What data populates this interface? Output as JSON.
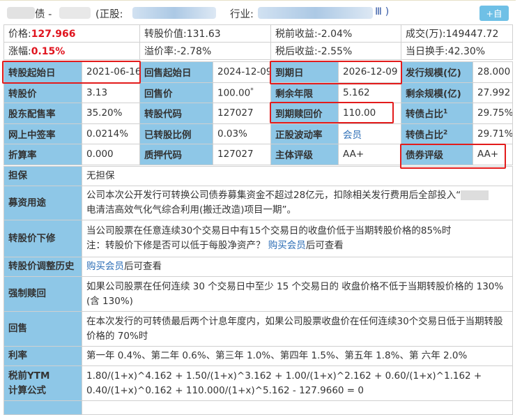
{
  "header": {
    "name_suffix": "债 -",
    "stock_label": "(正股:",
    "industry_label": "行业:",
    "industry_suffix": "Ⅲ )",
    "add_watch": "+自选"
  },
  "summary": [
    [
      {
        "label": "价格:",
        "value": "127.966",
        "highlight": true
      },
      {
        "label": "转股价值:",
        "value": "131.63"
      },
      {
        "label": "税前收益:",
        "value": "-2.04%"
      },
      {
        "label": "成交(万):",
        "value": "149447.72"
      }
    ],
    [
      {
        "label": "涨幅:",
        "value": "0.15%",
        "highlight": true
      },
      {
        "label": "溢价率:",
        "value": "-2.78%"
      },
      {
        "label": "税后收益:",
        "value": "-2.55%"
      },
      {
        "label": "当日换手:",
        "value": "42.30%"
      }
    ]
  ],
  "grid": [
    [
      "转股起始日",
      "2021-06-16",
      "回售起始日",
      "2024-12-09",
      "到期日",
      "2026-12-09",
      "发行规模(亿)",
      "28.000"
    ],
    [
      "转股价",
      "3.13",
      "回售价",
      "100.00",
      "剩余年限",
      "5.162",
      "剩余规模(亿)",
      "27.992"
    ],
    [
      "股东配售率",
      "35.20%",
      "转股代码",
      "127027",
      "到期赎回价",
      "110.00",
      "转债占比",
      "29.75%"
    ],
    [
      "网上中签率",
      "0.0214%",
      "已转股比例",
      "0.03%",
      "正股波动率",
      "会员",
      "转债占比",
      "29.71%"
    ],
    [
      "折算率",
      "0.000",
      "质押代码",
      "127027",
      "主体评级",
      "AA+",
      "债券评级",
      "AA+"
    ]
  ],
  "footnotes": {
    "putback_star": "*",
    "ratio1": "1",
    "ratio2": "2"
  },
  "details": {
    "guarantee": {
      "label": "担保",
      "text": "无担保"
    },
    "use_of_funds": {
      "label": "募资用途",
      "text": "公司本次公开发行可转换公司债券募集资金不超过28亿元，扣除相关发行费用后全部投入“",
      "text2": "电清洁高效气化气综合利用(搬迁改造)项目一期”。"
    },
    "price_revision": {
      "label": "转股价下修",
      "text": "当公司股票在任意连续30个交易日中有15个交易日的收盘价低于当期转股价格的85%时",
      "note": "注：转股价下修是否可以低于每股净资产？",
      "link": "购买会员",
      "after": "后可查看"
    },
    "revision_history": {
      "label": "转股价调整历史",
      "link": "购买会员",
      "after": "后可查看"
    },
    "forced_redemption": {
      "label": "强制赎回",
      "text": "如果公司股票在任何连续 30 个交易日中至少 15 个交易日的 收盘价格不低于当期转股价格的 130%(含 130%)"
    },
    "putback": {
      "label": "回售",
      "text": "在本次发行的可转债最后两个计息年度内，如果公司股票收盘价在任何连续30个交易日低于当期转股价格的 70%时"
    },
    "interest": {
      "label": "利率",
      "text": "第一年 0.4%、第二年 0.6%、第三年 1.0%、第四年 1.5%、第五年 1.8%、第 六年 2.0%"
    },
    "ytm": {
      "label1": "税前YTM",
      "label2": "计算公式",
      "line1": "1.80/(1+x)^4.162 + 1.50/(1+x)^3.162 + 1.00/(1+x)^2.162 + 0.60/(1+x)^1.162 +",
      "line2": "0.40/(1+x)^0.162 + 110.000/(1+x)^5.162 - 127.9660 = 0"
    }
  },
  "colors": {
    "label_bg": "#8ec7e7",
    "highlight": "#e0141e",
    "annotation": "#e31b1b",
    "link": "#2a6cb5"
  }
}
